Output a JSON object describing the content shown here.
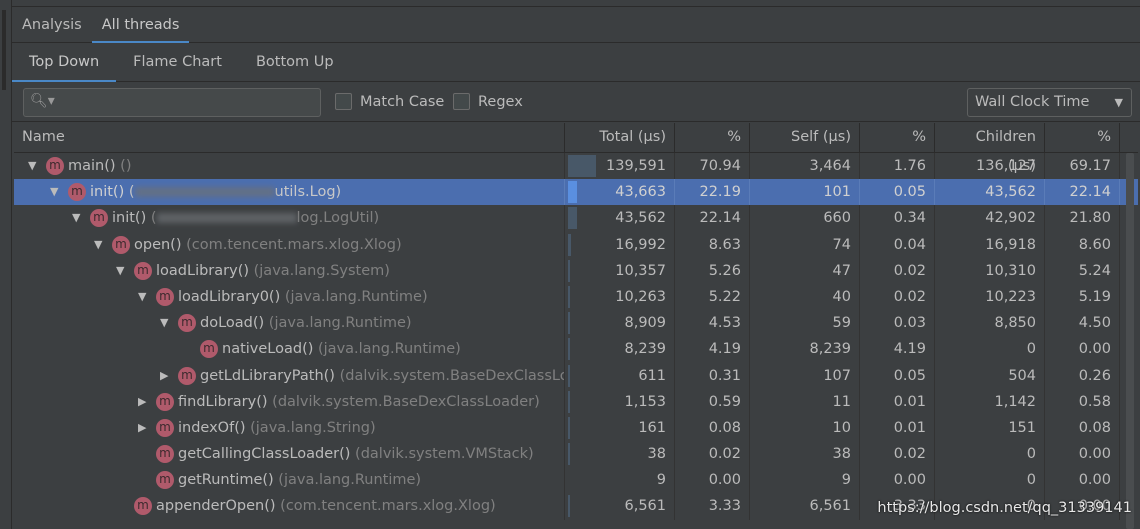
{
  "tabs_top": [
    {
      "label": "Analysis",
      "active": false
    },
    {
      "label": "All threads",
      "active": true
    }
  ],
  "tabs_view": [
    {
      "label": "Top Down",
      "active": true
    },
    {
      "label": "Flame Chart",
      "active": false
    },
    {
      "label": "Bottom Up",
      "active": false
    }
  ],
  "toolbar": {
    "search_placeholder": "",
    "search_icon": "search-icon",
    "match_case": "Match Case",
    "regex": "Regex",
    "clock_select": "Wall Clock Time"
  },
  "columns": [
    "Name",
    "Total (µs)",
    "%",
    "Self (µs)",
    "%",
    "Children (µs)",
    "%"
  ],
  "rows": [
    {
      "depth": 0,
      "expander": "expanded",
      "method": "main()",
      "cls": "()",
      "total": "139,591",
      "total_pct": "70.94",
      "self": "3,464",
      "self_pct": "1.76",
      "children": "136,127",
      "children_pct": "69.17",
      "bar_pct": 70.94
    },
    {
      "depth": 1,
      "expander": "expanded",
      "method": "init()",
      "cls": "(",
      "cls_tail": "utils.Log)",
      "blurred": true,
      "selected": true,
      "total": "43,663",
      "total_pct": "22.19",
      "self": "101",
      "self_pct": "0.05",
      "children": "43,562",
      "children_pct": "22.14",
      "bar_pct": 22.19
    },
    {
      "depth": 2,
      "expander": "expanded",
      "method": "init()",
      "cls": "(",
      "cls_tail": "log.LogUtil)",
      "blurred": true,
      "total": "43,562",
      "total_pct": "22.14",
      "self": "660",
      "self_pct": "0.34",
      "children": "42,902",
      "children_pct": "21.80",
      "bar_pct": 22.14
    },
    {
      "depth": 3,
      "expander": "expanded",
      "method": "open()",
      "cls": "(com.tencent.mars.xlog.Xlog)",
      "total": "16,992",
      "total_pct": "8.63",
      "self": "74",
      "self_pct": "0.04",
      "children": "16,918",
      "children_pct": "8.60",
      "bar_pct": 8.63
    },
    {
      "depth": 4,
      "expander": "expanded",
      "method": "loadLibrary()",
      "cls": "(java.lang.System)",
      "total": "10,357",
      "total_pct": "5.26",
      "self": "47",
      "self_pct": "0.02",
      "children": "10,310",
      "children_pct": "5.24",
      "bar_pct": 5.26
    },
    {
      "depth": 5,
      "expander": "expanded",
      "method": "loadLibrary0()",
      "cls": "(java.lang.Runtime)",
      "total": "10,263",
      "total_pct": "5.22",
      "self": "40",
      "self_pct": "0.02",
      "children": "10,223",
      "children_pct": "5.19",
      "bar_pct": 5.22
    },
    {
      "depth": 6,
      "expander": "expanded",
      "method": "doLoad()",
      "cls": "(java.lang.Runtime)",
      "total": "8,909",
      "total_pct": "4.53",
      "self": "59",
      "self_pct": "0.03",
      "children": "8,850",
      "children_pct": "4.50",
      "bar_pct": 4.53
    },
    {
      "depth": 7,
      "expander": "none",
      "method": "nativeLoad()",
      "cls": "(java.lang.Runtime)",
      "total": "8,239",
      "total_pct": "4.19",
      "self": "8,239",
      "self_pct": "4.19",
      "children": "0",
      "children_pct": "0.00",
      "bar_pct": 4.19
    },
    {
      "depth": 6,
      "expander": "collapsed",
      "method": "getLdLibraryPath()",
      "cls": "(dalvik.system.BaseDexClassLoader)",
      "total": "611",
      "total_pct": "0.31",
      "self": "107",
      "self_pct": "0.05",
      "children": "504",
      "children_pct": "0.26",
      "bar_pct": 0.31
    },
    {
      "depth": 5,
      "expander": "collapsed",
      "method": "findLibrary()",
      "cls": "(dalvik.system.BaseDexClassLoader)",
      "total": "1,153",
      "total_pct": "0.59",
      "self": "11",
      "self_pct": "0.01",
      "children": "1,142",
      "children_pct": "0.58",
      "bar_pct": 0.59
    },
    {
      "depth": 5,
      "expander": "collapsed",
      "method": "indexOf()",
      "cls": "(java.lang.String)",
      "total": "161",
      "total_pct": "0.08",
      "self": "10",
      "self_pct": "0.01",
      "children": "151",
      "children_pct": "0.08",
      "bar_pct": 0.08
    },
    {
      "depth": 5,
      "expander": "none-shift",
      "method": "getCallingClassLoader()",
      "cls": "(dalvik.system.VMStack)",
      "total": "38",
      "total_pct": "0.02",
      "self": "38",
      "self_pct": "0.02",
      "children": "0",
      "children_pct": "0.00",
      "bar_pct": 0.02
    },
    {
      "depth": 5,
      "expander": "none-shift",
      "method": "getRuntime()",
      "cls": "(java.lang.Runtime)",
      "total": "9",
      "total_pct": "0.00",
      "self": "9",
      "self_pct": "0.00",
      "children": "0",
      "children_pct": "0.00",
      "bar_pct": 0
    },
    {
      "depth": 4,
      "expander": "none-shift",
      "method": "appenderOpen()",
      "cls": "(com.tencent.mars.xlog.Xlog)",
      "total": "6,561",
      "total_pct": "3.33",
      "self": "6,561",
      "self_pct": "3.33",
      "children": "0",
      "children_pct": "0.00",
      "bar_pct": 3.33
    }
  ],
  "watermark": "https://blog.csdn.net/qq_31339141",
  "colors": {
    "accent": "#4a88c7",
    "selection": "#4b6eaf",
    "method_badge": "#b05a6b",
    "background": "#3c3f41"
  }
}
